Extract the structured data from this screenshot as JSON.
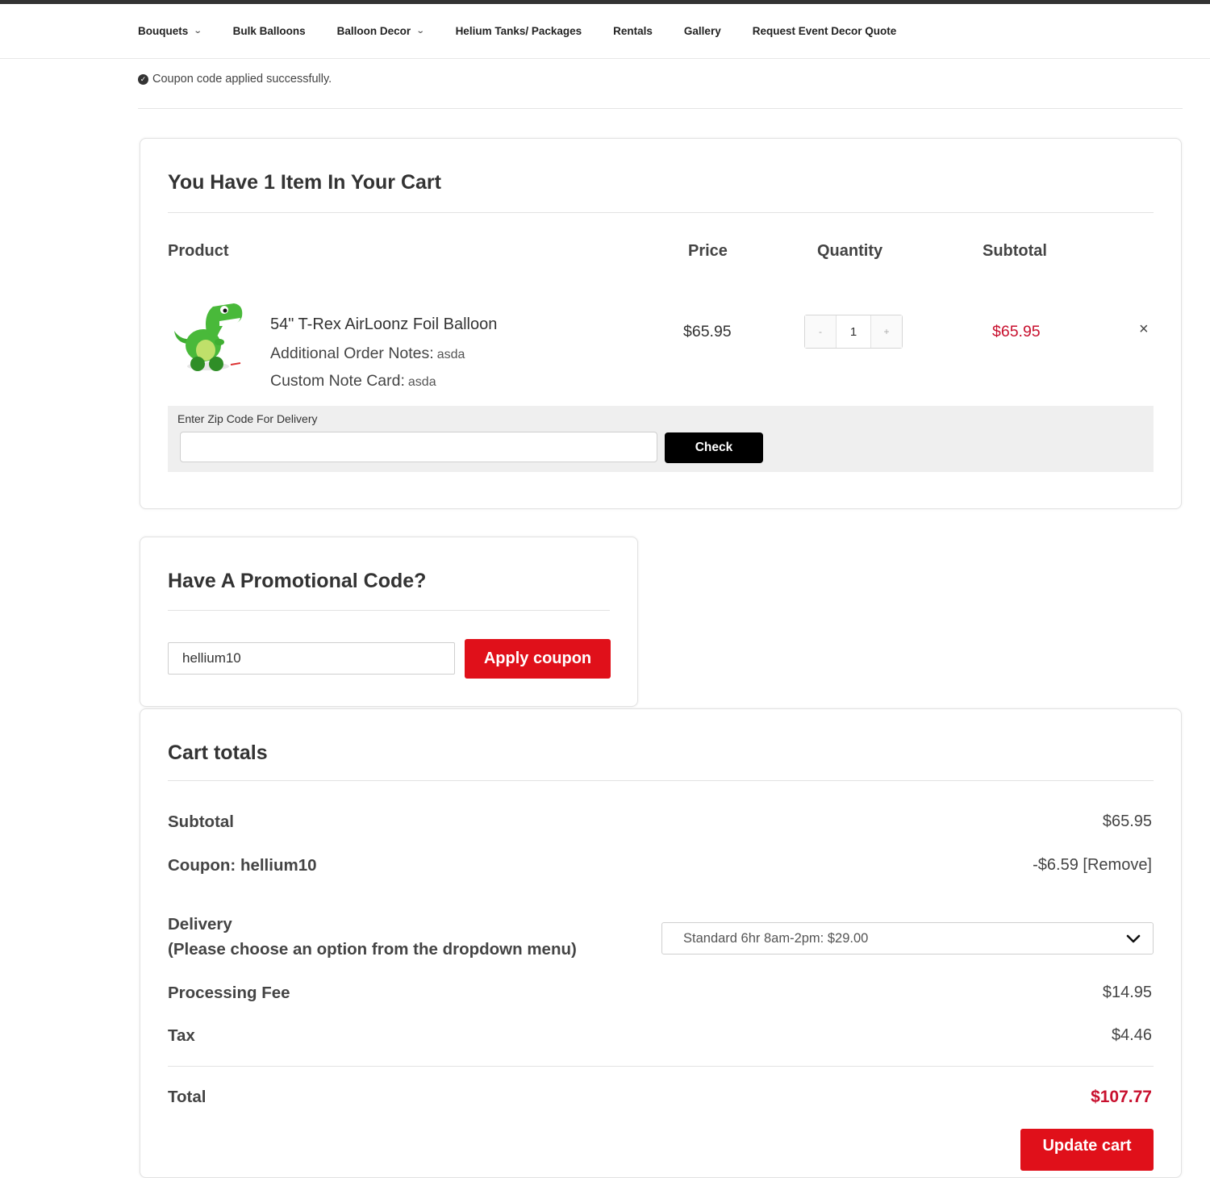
{
  "nav": {
    "items": [
      {
        "label": "Bouquets",
        "has_dropdown": true
      },
      {
        "label": "Bulk Balloons",
        "has_dropdown": false
      },
      {
        "label": "Balloon Decor",
        "has_dropdown": true
      },
      {
        "label": "Helium Tanks/ Packages",
        "has_dropdown": false
      },
      {
        "label": "Rentals",
        "has_dropdown": false
      },
      {
        "label": "Gallery",
        "has_dropdown": false
      },
      {
        "label": "Request Event Decor Quote",
        "has_dropdown": false
      }
    ]
  },
  "notice": {
    "text": "Coupon code applied successfully."
  },
  "cart": {
    "title": "You Have 1 Item In Your Cart",
    "columns": {
      "product": "Product",
      "price": "Price",
      "quantity": "Quantity",
      "subtotal": "Subtotal"
    },
    "item": {
      "name": "54\" T-Rex AirLoonz Foil Balloon",
      "notes_label": "Additional Order Notes:",
      "notes_value": "asda",
      "card_label": "Custom Note Card:",
      "card_value": "asda",
      "price": "$65.95",
      "quantity": "1",
      "qty_minus": "-",
      "qty_plus": "+",
      "subtotal": "$65.95",
      "remove": "×"
    },
    "zip": {
      "label": "Enter Zip Code For Delivery",
      "value": "",
      "button": "Check"
    }
  },
  "promo": {
    "title": "Have A Promotional Code?",
    "input_value": "hellium10",
    "button": "Apply coupon"
  },
  "totals": {
    "title": "Cart totals",
    "subtotal_label": "Subtotal",
    "subtotal_value": "$65.95",
    "coupon_label": "Coupon: hellium10",
    "coupon_value": "-$6.59",
    "coupon_remove": "[Remove]",
    "delivery_label": "Delivery",
    "delivery_hint": "(Please choose an option from the dropdown menu)",
    "delivery_selected": "Standard 6hr 8am-2pm: $29.00",
    "processing_label": "Processing Fee",
    "processing_value": "$14.95",
    "tax_label": "Tax",
    "tax_value": "$4.46",
    "total_label": "Total",
    "total_value": "$107.77",
    "update_button": "Update cart"
  },
  "colors": {
    "accent_red": "#e0101a",
    "price_red": "#c8102e",
    "check_button": "#000000"
  }
}
